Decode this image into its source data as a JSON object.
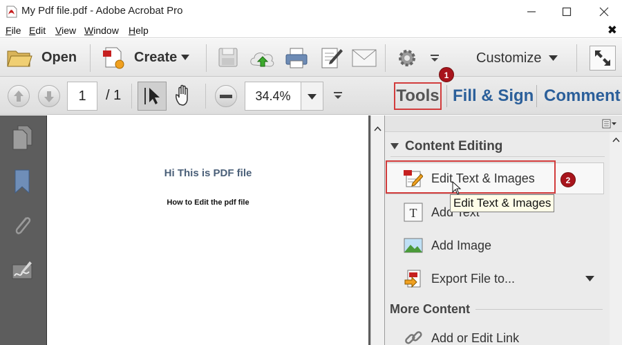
{
  "window": {
    "title": "My Pdf file.pdf - Adobe Acrobat Pro"
  },
  "menu": {
    "items": [
      "File",
      "Edit",
      "View",
      "Window",
      "Help"
    ],
    "mnemonics": [
      "F",
      "E",
      "V",
      "W",
      "H"
    ]
  },
  "toolbar": {
    "open_label": "Open",
    "create_label": "Create",
    "customize_label": "Customize"
  },
  "nav": {
    "page_current": "1",
    "page_separator": "/ 1",
    "zoom": "34.4%"
  },
  "tabs": {
    "tools": "Tools",
    "fill_sign": "Fill & Sign",
    "comment": "Comment"
  },
  "badges": {
    "step1": "1",
    "step2": "2"
  },
  "document": {
    "title": "Hi This is PDF file",
    "subtitle": "How to Edit the pdf file"
  },
  "panel": {
    "section_title": "Content Editing",
    "tools": [
      {
        "label": "Edit Text & Images",
        "icon": "edit-text-images-icon"
      },
      {
        "label": "Add Text",
        "icon": "add-text-icon"
      },
      {
        "label": "Add Image",
        "icon": "add-image-icon"
      },
      {
        "label": "Export File to...",
        "icon": "export-file-icon"
      }
    ],
    "more_title": "More Content",
    "more_tools": [
      {
        "label": "Add or Edit Link",
        "icon": "link-icon"
      }
    ],
    "tooltip": "Edit Text & Images"
  },
  "colors": {
    "accent_blue": "#2b5f9a",
    "highlight_red": "#d23b3b",
    "badge_red": "#a8141c",
    "nav_gray": "#5d5d5d"
  }
}
